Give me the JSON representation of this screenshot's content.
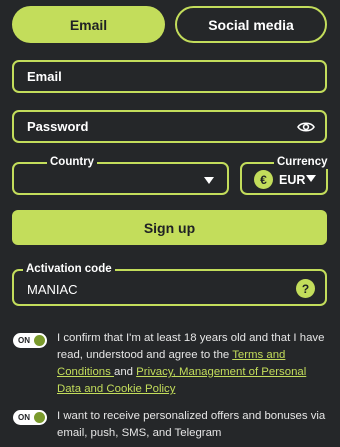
{
  "tabs": {
    "email": "Email",
    "social": "Social media"
  },
  "form": {
    "email_placeholder": "Email",
    "password_placeholder": "Password",
    "country_label": "Country",
    "country_value": "",
    "currency_label": "Currency",
    "currency_symbol": "€",
    "currency_value": "EUR",
    "signup_label": "Sign up",
    "activation_label": "Activation code",
    "activation_value": "MANIAC",
    "help_symbol": "?"
  },
  "consents": [
    {
      "toggle_label": "ON",
      "text_before": "I confirm that I'm at least 18 years old and that I have read, understood and agree to the ",
      "link1": "Terms and Conditions ",
      "text_middle": "and ",
      "link2": "Privacy, Management of Personal Data and Cookie Policy",
      "enabled": true
    },
    {
      "toggle_label": "ON",
      "text": "I want to receive personalized offers and bonuses via email, push, SMS, and Telegram",
      "enabled": true
    }
  ],
  "colors": {
    "accent": "#c3dd5b",
    "background": "#252729",
    "toggle_knob": "#7a9a2c"
  }
}
